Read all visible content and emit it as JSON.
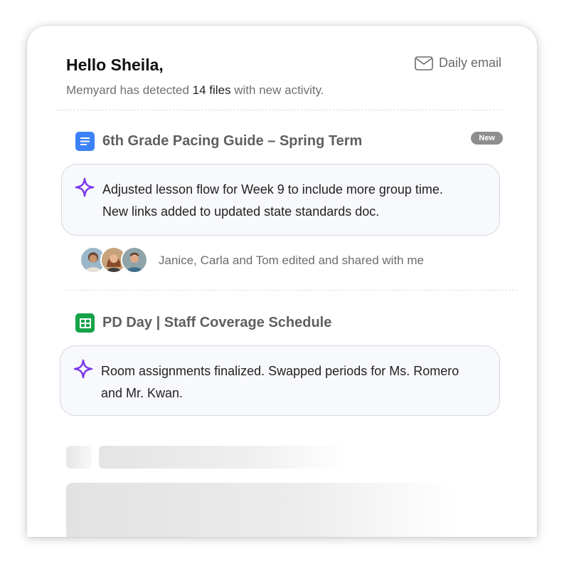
{
  "header": {
    "greeting": "Hello Sheila,",
    "subline_prefix": "Memyard has detected ",
    "subline_count": "14 files",
    "subline_suffix": " with new activity.",
    "daily_email_label": "Daily email"
  },
  "files": [
    {
      "title": "6th Grade Pacing Guide – Spring Term",
      "type_icon": "google-docs-icon",
      "badge": "New",
      "summary_line1": "Adjusted lesson flow for Week 9 to include more group time.",
      "summary_line2": "New links added to updated state standards doc.",
      "editors_text": "Janice, Carla and Tom edited and shared with me"
    },
    {
      "title": "PD Day | Staff Coverage Schedule",
      "type_icon": "google-sheets-icon",
      "summary_line1": "Room assignments finalized. Swapped periods for Ms. Romero",
      "summary_line2": "and Mr. Kwan."
    }
  ],
  "colors": {
    "docs_blue": "#3b82f6",
    "sheets_green": "#16a34a",
    "ai_purple": "#7c3aed",
    "badge_gray": "#8e8e8e"
  }
}
